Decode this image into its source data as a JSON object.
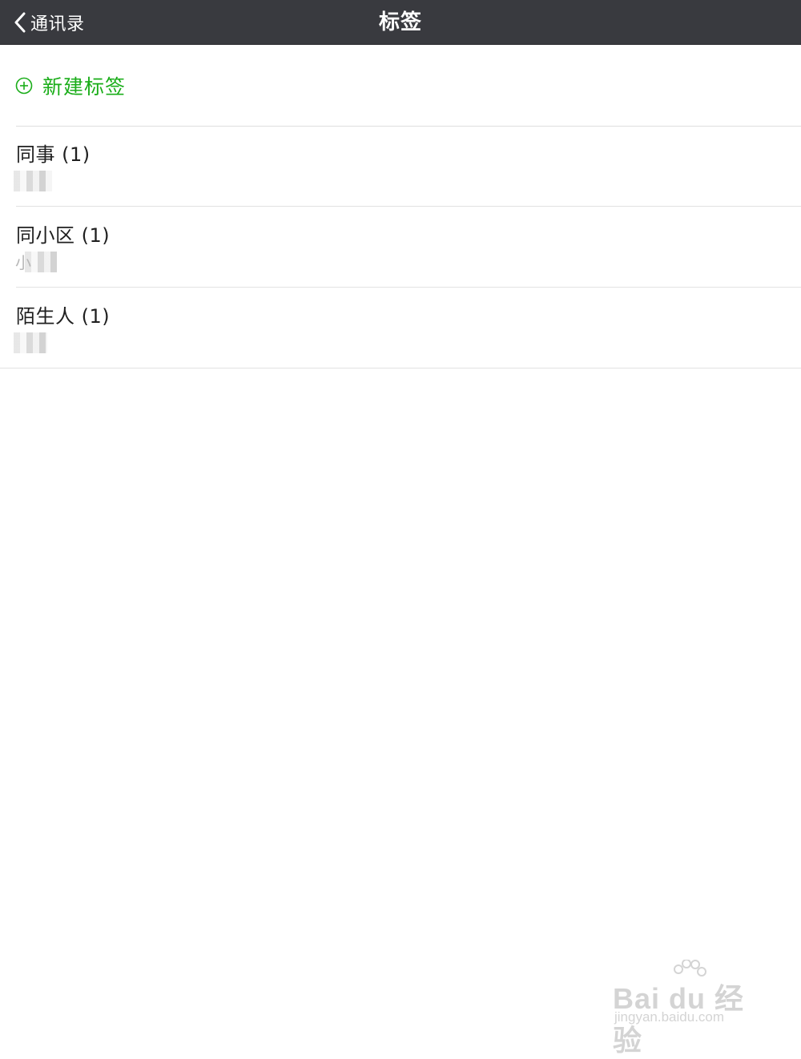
{
  "navbar": {
    "back_label": "通讯录",
    "title": "标签",
    "background_color": "#393a3f",
    "back_icon": "chevron-left-icon"
  },
  "new_tag": {
    "label": "新建标签",
    "icon": "plus-circle-icon",
    "accent_color": "#1aad19"
  },
  "tags": [
    {
      "name": "同事 (1)",
      "member_preview": ""
    },
    {
      "name": "同小区 (1)",
      "member_preview": "小"
    },
    {
      "name": "陌生人 (1)",
      "member_preview": ""
    }
  ],
  "watermark": {
    "main": "Bai du 经验",
    "sub": "jingyan.baidu.com"
  }
}
